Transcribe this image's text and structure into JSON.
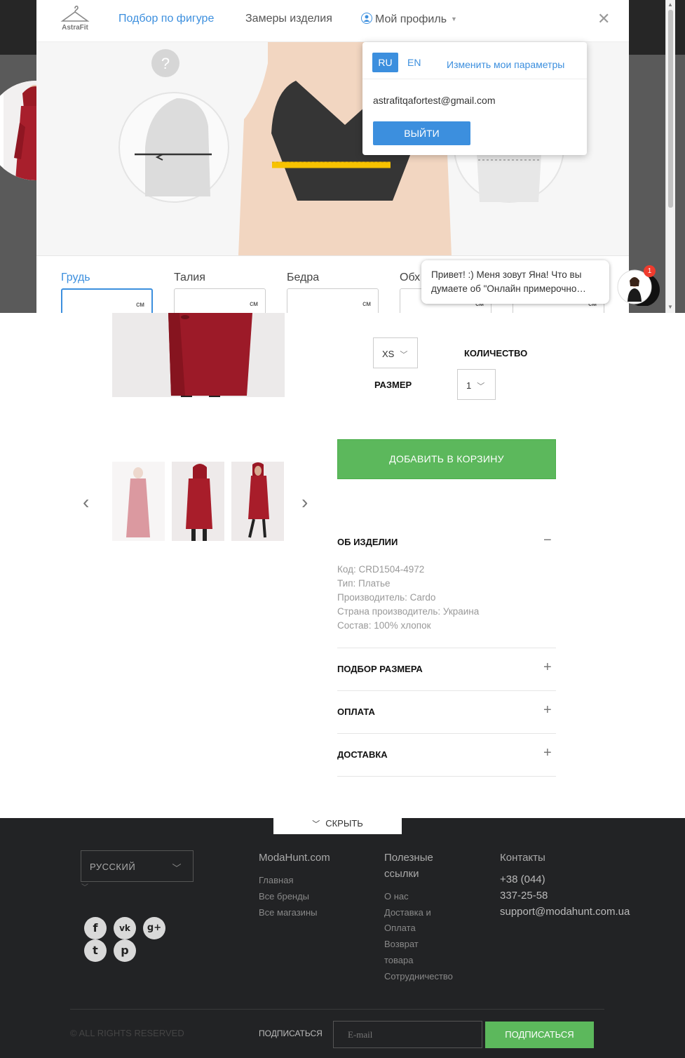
{
  "modal": {
    "logo_text": "AstraFit",
    "nav": {
      "fit": "Подбор по фигуре",
      "measurements": "Замеры изделия",
      "profile": "Мой профиль"
    },
    "help_symbol": "?",
    "fields": [
      {
        "label": "Грудь",
        "unit": "см"
      },
      {
        "label": "Талия",
        "unit": "см"
      },
      {
        "label": "Бедра",
        "unit": "см"
      },
      {
        "label": "Обх",
        "unit": "см"
      },
      {
        "label": "",
        "unit": "см"
      }
    ]
  },
  "profile_dropdown": {
    "lang_ru": "RU",
    "lang_en": "EN",
    "change_params": "Изменить мои параметры",
    "email": "astrafitqafortest@gmail.com",
    "logout": "ВЫЙТИ"
  },
  "chat": {
    "message": "Привет! :) Меня зовут Яна! Что вы думаете об \"Онлайн примерочно…",
    "badge_count": "1"
  },
  "product": {
    "size_value": "XS",
    "size_label": "РАЗМЕР",
    "qty_label": "КОЛИЧЕСТВО",
    "qty_value": "1",
    "add_to_cart": "ДОБАВИТЬ В КОРЗИНУ",
    "about_title": "ОБ ИЗДЕЛИИ",
    "specs": [
      "Код: CRD1504-4972",
      "Тип: Платье",
      "Производитель: Cardo",
      "Страна производитель: Украина",
      "Состав: 100% хлопок"
    ],
    "sections": [
      "ПОДБОР РАЗМЕРА",
      "ОПЛАТА",
      "ДОСТАВКА"
    ]
  },
  "footer": {
    "hide_label": "СКРЫТЬ",
    "language": "РУССКИЙ",
    "col1_title": "ModaHunt.com",
    "col1_links": [
      "Главная",
      "Все бренды",
      "Все магазины"
    ],
    "col2_title_1": "Полезные",
    "col2_title_2": "ссылки",
    "col2_links": [
      "О нас",
      "Доставка и",
      "Оплата",
      "Возврат",
      "товара",
      "Сотрудничество"
    ],
    "col3_title": "Контакты",
    "contacts": [
      "+38 (044)",
      "337-25-58",
      "support@modahunt.com.ua"
    ],
    "copyright": "© ALL RIGHTS RESERVED",
    "subscribe_label": "ПОДПИСАТЬСЯ",
    "email_placeholder": "E-mail",
    "subscribe_button": "ПОДПИСАТЬСЯ",
    "social_glyphs": {
      "facebook": "f",
      "vk": "vk",
      "google": "g+",
      "twitter": "t",
      "pinterest": "p"
    }
  }
}
